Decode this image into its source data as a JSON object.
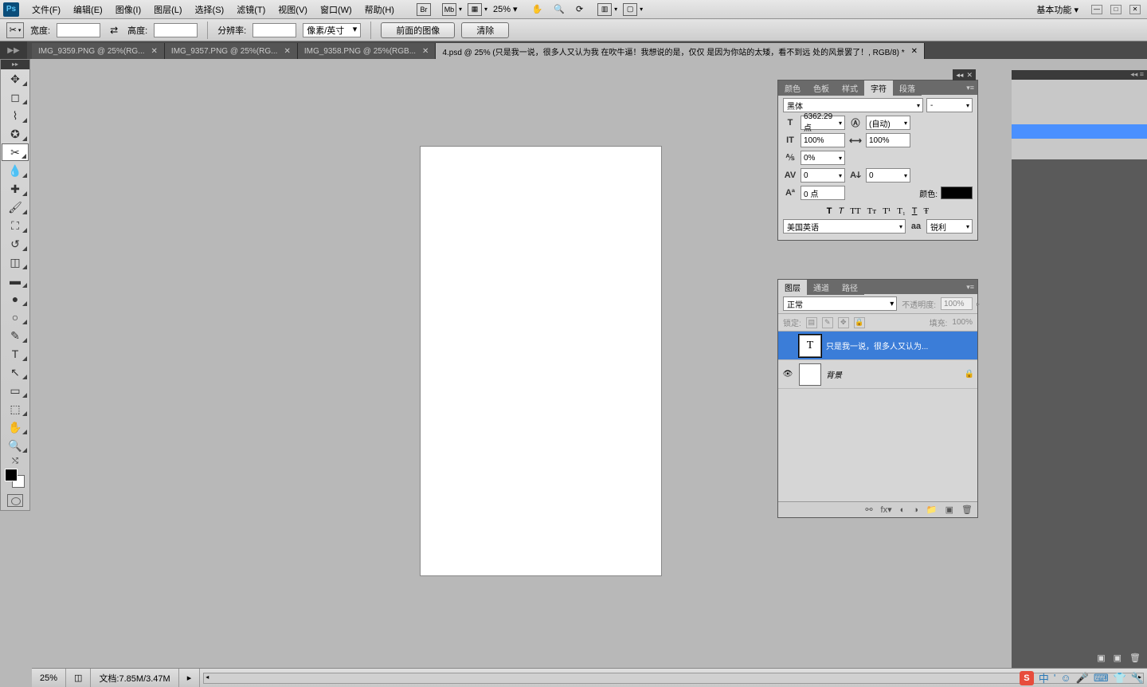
{
  "app": {
    "logo": "Ps"
  },
  "menu": {
    "file": "文件(F)",
    "edit": "编辑(E)",
    "image": "图像(I)",
    "layer": "图层(L)",
    "select": "选择(S)",
    "filter": "滤镜(T)",
    "view": "视图(V)",
    "window": "窗口(W)",
    "help": "帮助(H)"
  },
  "menubar_extras": {
    "br": "Br",
    "mb": "Mb",
    "zoom": "25%",
    "workspace": "基本功能"
  },
  "options": {
    "width_label": "宽度:",
    "height_label": "高度:",
    "swap": "⇄",
    "res_label": "分辨率:",
    "res_unit": "像素/英寸",
    "front_btn": "前面的图像",
    "clear_btn": "清除"
  },
  "tabs": [
    {
      "label": "IMG_9359.PNG @ 25%(RG...",
      "active": false
    },
    {
      "label": "IMG_9357.PNG @ 25%(RG...",
      "active": false
    },
    {
      "label": "IMG_9358.PNG @ 25%(RGB...",
      "active": false
    },
    {
      "label": "4.psd @ 25% (只是我一说，很多人又认为我 在吹牛逼！我想说的是，仅仅 是因为你站的太矮，看不到远 处的风景罢了！, RGB/8) *",
      "active": true
    }
  ],
  "char_panel": {
    "tabs": {
      "color": "颜色",
      "swatch": "色板",
      "style": "样式",
      "character": "字符",
      "paragraph": "段落"
    },
    "font": "黑体",
    "font_style": "-",
    "size": "6362.29 点",
    "leading": "(自动)",
    "vscale": "100%",
    "hscale": "100%",
    "tracking": "0%",
    "kerning": "0",
    "kerning2": "0",
    "baseline": "0 点",
    "color_label": "颜色:",
    "lang": "美国英语",
    "aa_prefix": "aa",
    "aa": "锐利"
  },
  "layers_panel": {
    "tabs": {
      "layers": "图层",
      "channels": "通道",
      "paths": "路径"
    },
    "blend": "正常",
    "opacity_label": "不透明度:",
    "opacity": "100%",
    "lock_label": "锁定:",
    "fill_label": "填充:",
    "fill": "100%",
    "layers": [
      {
        "thumb": "T",
        "name": "只是我一说，很多人又认为...",
        "selected": true,
        "visible": false,
        "locked": false
      },
      {
        "thumb": "",
        "name": "背景",
        "selected": false,
        "visible": true,
        "locked": true
      }
    ]
  },
  "status": {
    "zoom": "25%",
    "doc": "文档:7.85M/3.47M"
  },
  "ime": {
    "s": "S",
    "lang": "中"
  }
}
